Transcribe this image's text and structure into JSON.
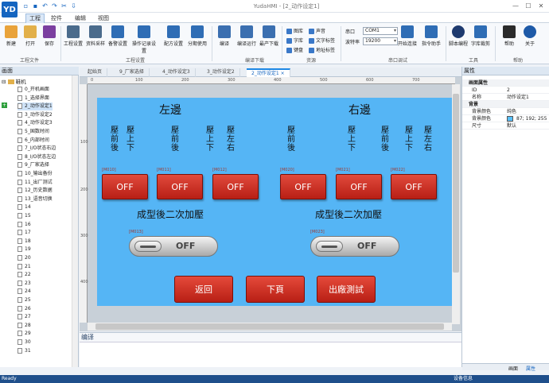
{
  "app": {
    "logo": "YD",
    "title": "YudaHMI - [2_动作设定1]",
    "win_min": "—",
    "win_max": "☐",
    "win_close": "✕"
  },
  "menu": [
    {
      "label": "工程"
    },
    {
      "label": "控件"
    },
    {
      "label": "编辑"
    },
    {
      "label": "视图"
    }
  ],
  "ribbon": {
    "file": [
      {
        "label": "新建"
      },
      {
        "label": "打开"
      },
      {
        "label": "保存"
      }
    ],
    "file_group": "工程文件",
    "settings": [
      {
        "label": "工程设置"
      },
      {
        "label": "资料采样"
      },
      {
        "label": "备警设置"
      },
      {
        "label": "操作记录设置"
      },
      {
        "label": "配方设置"
      },
      {
        "label": "分期使用"
      }
    ],
    "settings_group": "工程设置",
    "compile": [
      {
        "label": "编译"
      },
      {
        "label": "编译运行"
      },
      {
        "label": "最产下载"
      }
    ],
    "compile_group": "编译下载",
    "resources": [
      {
        "label": "图库"
      },
      {
        "label": "声音"
      },
      {
        "label": "字库"
      },
      {
        "label": "文字标签"
      },
      {
        "label": "键盘"
      },
      {
        "label": "地址标签"
      }
    ],
    "resources_group": "资源",
    "serial_port_label": "串口",
    "serial_port_value": "COM1",
    "baud_label": "波特率",
    "baud_value": "19200",
    "debug": [
      {
        "label": "开始连接"
      },
      {
        "label": "指令助手"
      }
    ],
    "debug_group": "串口调试",
    "tools": [
      {
        "label": "脚本编程"
      },
      {
        "label": "字库裁剪"
      }
    ],
    "tools_group": "工具",
    "help": [
      {
        "label": "帮助"
      },
      {
        "label": "关于"
      }
    ],
    "help_group": "帮助"
  },
  "left_panel": {
    "title": "画面",
    "root": "鞋机",
    "items": [
      "0_开机画面",
      "1_选择界面",
      "2_动作设定1",
      "3_动作设定2",
      "4_动作设定3",
      "5_国数时间",
      "6_内部时间",
      "7_I/O状态右边",
      "8_I/O状态左边",
      "9_厂家选择",
      "10_输出备份",
      "11_出厂测试",
      "12_历史数据",
      "13_语音切换",
      "14",
      "15",
      "16",
      "17",
      "18",
      "19",
      "20",
      "21",
      "22",
      "23",
      "24",
      "25",
      "26",
      "27",
      "28",
      "29",
      "30",
      "31"
    ]
  },
  "tabs": [
    {
      "label": "起始页"
    },
    {
      "label": "9_厂家选择"
    },
    {
      "label": "4_动作设定3"
    },
    {
      "label": "3_动作设定2"
    },
    {
      "label": "2_动作设定1"
    }
  ],
  "tab_close": "×",
  "rulers": {
    "h": [
      "0",
      "100",
      "200",
      "300",
      "400",
      "500",
      "600",
      "700"
    ],
    "v": [
      "100",
      "200",
      "300",
      "400"
    ]
  },
  "screen": {
    "left_title": "左邊",
    "right_title": "右邊",
    "columns": [
      {
        "text": "壓前後"
      },
      {
        "text": "壓上下"
      },
      {
        "text": "壓前後"
      },
      {
        "text": "壓上下"
      },
      {
        "text": "壓左右"
      },
      {
        "text": "壓前後"
      },
      {
        "text": "壓上下"
      },
      {
        "text": "壓前後"
      },
      {
        "text": "壓上下"
      },
      {
        "text": "壓左右"
      }
    ],
    "switches": [
      {
        "tag": "[M010]",
        "label": "OFF"
      },
      {
        "tag": "[M011]",
        "label": "OFF"
      },
      {
        "tag": "[M012]",
        "label": "OFF"
      },
      {
        "tag": "[M020]",
        "label": "OFF"
      },
      {
        "tag": "[M021]",
        "label": "OFF"
      },
      {
        "tag": "[M022]",
        "label": "OFF"
      }
    ],
    "left_sub": "成型後二次加壓",
    "right_sub": "成型後二次加壓",
    "toggles": [
      {
        "tag": "[M013]",
        "label": "OFF"
      },
      {
        "tag": "[M023]",
        "label": "OFF"
      }
    ],
    "nav": [
      {
        "label": "返回"
      },
      {
        "label": "下頁"
      },
      {
        "label": "出廠測試"
      }
    ]
  },
  "compile_panel": {
    "title": "编译"
  },
  "properties": {
    "title": "属性",
    "rows": [
      {
        "cat": true,
        "k": "画面属性",
        "v": ""
      },
      {
        "k": "ID",
        "v": "2"
      },
      {
        "k": "名称",
        "v": "动作设定1"
      },
      {
        "cat": true,
        "k": "背景",
        "v": ""
      },
      {
        "k": "背景颜色",
        "v": "纯色"
      },
      {
        "k": "背景颜色",
        "v": "87; 192; 255"
      },
      {
        "k": "尺寸",
        "v": "默认"
      }
    ],
    "tabs": [
      {
        "label": "画面"
      },
      {
        "label": "属性"
      }
    ],
    "bg_swatch": "#57c0ff"
  },
  "status": {
    "left": "Ready",
    "right": "设备信息"
  }
}
